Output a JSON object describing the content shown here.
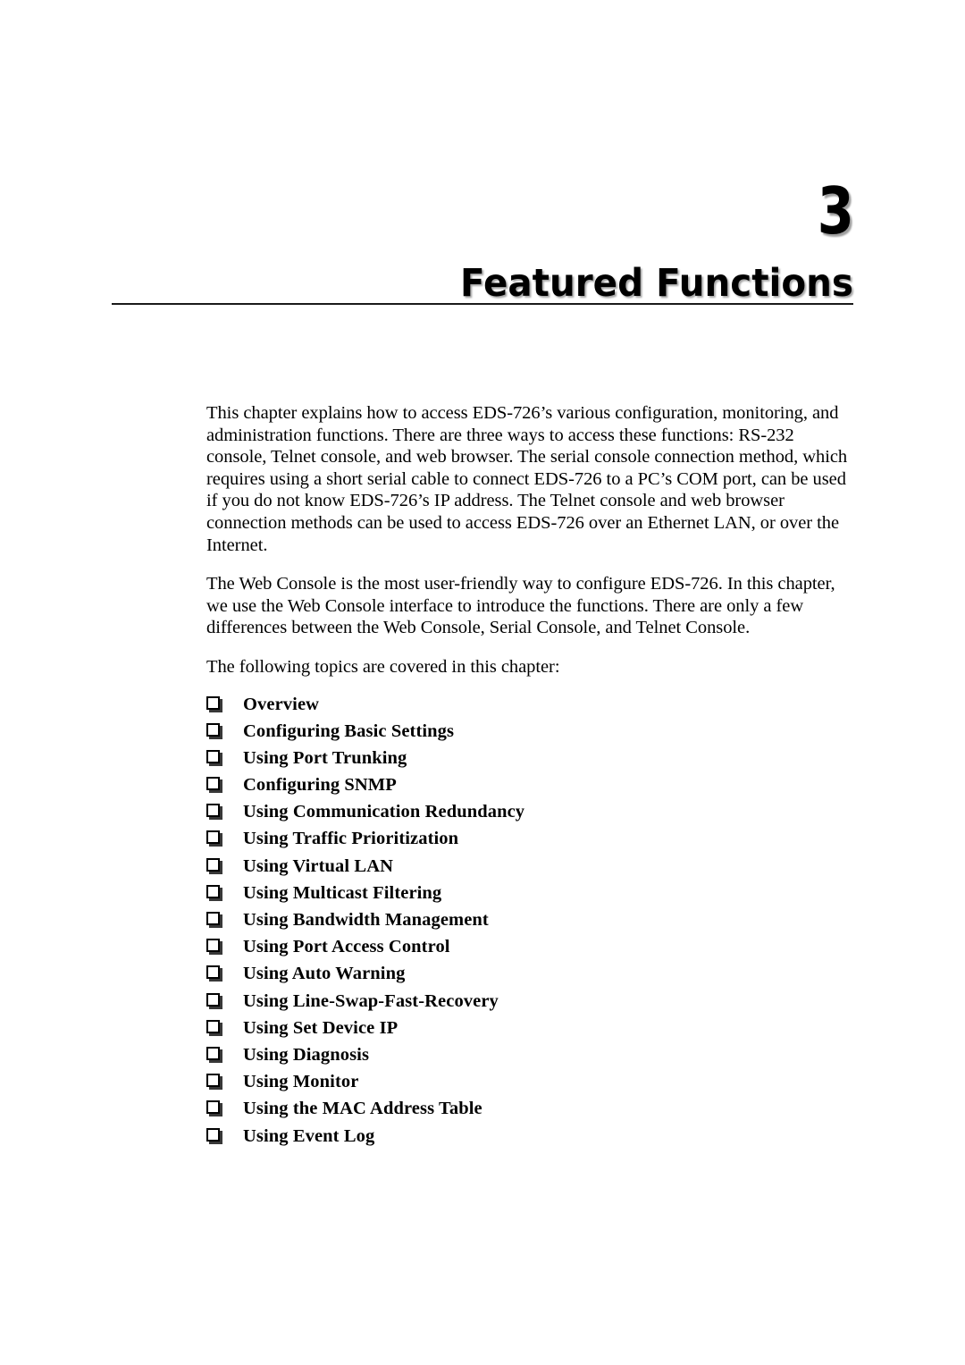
{
  "chapter": {
    "number": "3",
    "title": "Featured Functions"
  },
  "intro": {
    "paragraph_1": "This chapter explains how to access EDS-726’s various configuration, monitoring, and administration functions. There are three ways to access these functions: RS-232 console, Telnet console, and web browser. The serial console connection method, which requires using a short serial cable to connect EDS-726 to a PC’s COM port, can be used if you do not know EDS-726’s IP address. The Telnet console and web browser connection methods can be used to access EDS-726 over an Ethernet LAN, or over the Internet.",
    "paragraph_2": "The Web Console is the most user-friendly way to configure EDS-726. In this chapter, we use the Web Console interface to introduce the functions. There are only a few differences between the Web Console, Serial Console, and Telnet Console.",
    "paragraph_3": "The following topics are covered in this chapter:"
  },
  "topics": [
    {
      "label": "Overview"
    },
    {
      "label": "Configuring Basic Settings"
    },
    {
      "label": "Using Port Trunking"
    },
    {
      "label": "Configuring SNMP"
    },
    {
      "label": "Using Communication Redundancy"
    },
    {
      "label": "Using Traffic Prioritization"
    },
    {
      "label": "Using Virtual LAN"
    },
    {
      "label": "Using Multicast Filtering"
    },
    {
      "label": "Using Bandwidth Management"
    },
    {
      "label": "Using Port Access Control"
    },
    {
      "label": "Using Auto Warning"
    },
    {
      "label": "Using Line-Swap-Fast-Recovery"
    },
    {
      "label": "Using Set Device IP"
    },
    {
      "label": "Using Diagnosis"
    },
    {
      "label": "Using Monitor"
    },
    {
      "label": "Using the MAC Address Table"
    },
    {
      "label": "Using Event Log"
    }
  ],
  "colors": {
    "text": "#000000",
    "page_background": "#ffffff",
    "rule": "#1a1a1a"
  }
}
